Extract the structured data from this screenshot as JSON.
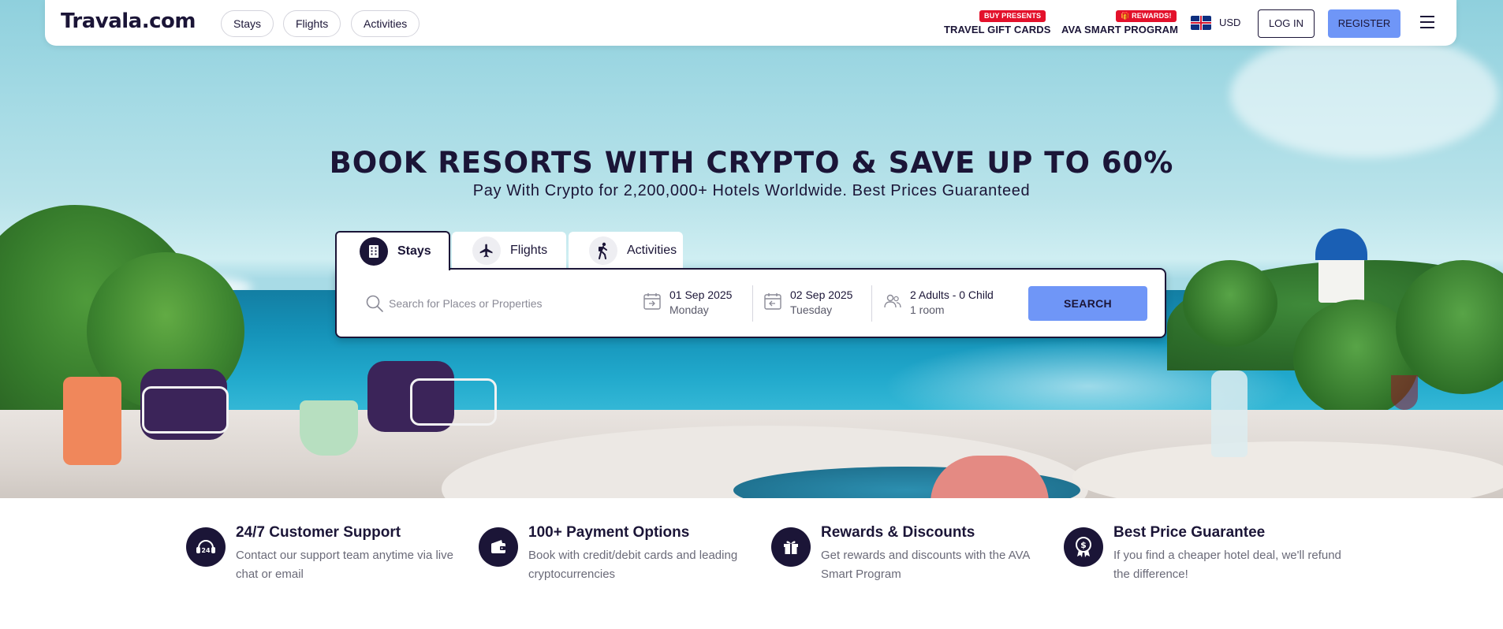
{
  "header": {
    "logo": "Travala.com",
    "nav": [
      "Stays",
      "Flights",
      "Activities"
    ],
    "gift_cards": {
      "badge": "BUY PRESENTS",
      "label": "TRAVEL GIFT CARDS"
    },
    "smart_program": {
      "badge": "🎁 REWARDS!",
      "label": "AVA SMART PROGRAM"
    },
    "currency": "USD",
    "login": "LOG IN",
    "register": "REGISTER"
  },
  "hero": {
    "title": "BOOK RESORTS WITH CRYPTO & SAVE UP TO 60%",
    "subtitle": "Pay With Crypto for 2,200,000+ Hotels Worldwide. Best Prices Guaranteed"
  },
  "search": {
    "tabs": [
      {
        "label": "Stays",
        "icon": "building-icon",
        "active": true
      },
      {
        "label": "Flights",
        "icon": "airplane-icon",
        "active": false
      },
      {
        "label": "Activities",
        "icon": "hiker-icon",
        "active": false
      }
    ],
    "placeholder": "Search for Places or Properties",
    "checkin": {
      "date": "01 Sep 2025",
      "day": "Monday"
    },
    "checkout": {
      "date": "02 Sep 2025",
      "day": "Tuesday"
    },
    "guests": {
      "summary": "2 Adults - 0 Child",
      "rooms": "1 room"
    },
    "button": "SEARCH"
  },
  "features": [
    {
      "icon": "support-24-icon",
      "title": "24/7 Customer Support",
      "desc": "Contact our support team anytime via live chat or email"
    },
    {
      "icon": "wallet-icon",
      "title": "100+ Payment Options",
      "desc": "Book with credit/debit cards and leading cryptocurrencies"
    },
    {
      "icon": "gift-icon",
      "title": "Rewards & Discounts",
      "desc": "Get rewards and discounts with the AVA Smart Program"
    },
    {
      "icon": "price-badge-icon",
      "title": "Best Price Guarantee",
      "desc": "If you find a cheaper hotel deal, we'll refund the difference!"
    }
  ],
  "colors": {
    "brand_dark": "#1b1537",
    "accent_blue": "#6f96f7",
    "badge_red": "#e3112b"
  }
}
